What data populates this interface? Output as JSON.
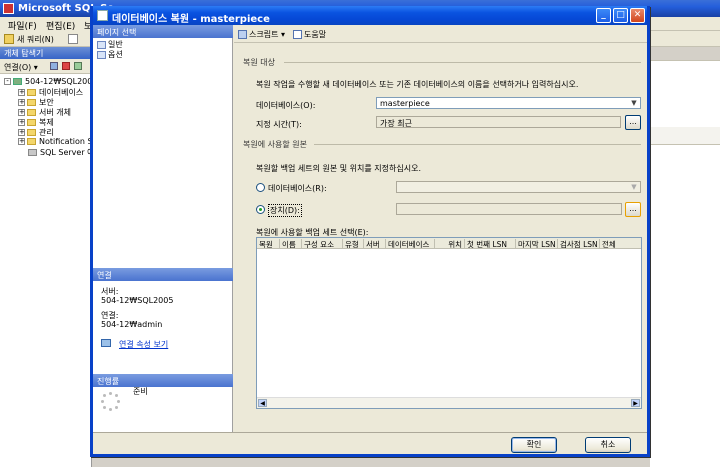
{
  "background_app": {
    "title": "Microsoft SQL Se",
    "menu": [
      "파일(F)",
      "편집(E)",
      "보"
    ],
    "toolbar_new_query": "새 쿼리(N)",
    "explorer_title": "개체 탐색기",
    "explorer_connect": "연결(O) ▾",
    "tree": [
      {
        "label": "504-12₩SQL2005",
        "expander": "-"
      },
      {
        "label": "데이터베이스",
        "expander": "+"
      },
      {
        "label": "보안",
        "expander": "+"
      },
      {
        "label": "서버 개체",
        "expander": "+"
      },
      {
        "label": "복제",
        "expander": "+"
      },
      {
        "label": "관리",
        "expander": "+"
      },
      {
        "label": "Notification Se",
        "expander": "+"
      },
      {
        "label": "SQL Server 에",
        "expander": ""
      }
    ]
  },
  "dialog": {
    "title": "데이터베이스 복원 - masterpiece",
    "left": {
      "page_select_header": "페이지 선택",
      "pages": [
        "일반",
        "옵션"
      ],
      "connection_header": "연결",
      "server_label": "서버:",
      "server_value": "504-12₩SQL2005",
      "conn_label": "연결:",
      "conn_value": "504-12₩admin",
      "conn_props_link": "연결 속성 보기",
      "progress_header": "진행률",
      "progress_status": "준비"
    },
    "toolbar": {
      "script": "스크립트",
      "help": "도움말"
    },
    "restore_target": {
      "section": "복원 대상",
      "description": "복원 작업을 수행할 새 데이터베이스 또는 기존 데이터베이스의 이름을 선택하거나 입력하십시오.",
      "db_label": "데이터베이스(O):",
      "db_value": "masterpiece",
      "time_label": "지정 시간(T):",
      "time_value": "가장 최근"
    },
    "restore_source": {
      "section": "복원에 사용할 원본",
      "description": "복원할 백업 세트의 원본 및 위치를 지정하십시오.",
      "from_db_label": "데이터베이스(R):",
      "from_device_label": "장치(D):",
      "selected": "device",
      "backup_sets_label": "복원에 사용할 백업 세트 선택(E):",
      "columns": [
        "복원",
        "이름",
        "구성 요소",
        "유형",
        "서버",
        "데이터베이스",
        "위치",
        "첫 번째 LSN",
        "마지막 LSN",
        "검사점 LSN",
        "전체"
      ]
    },
    "buttons": {
      "ok": "확인",
      "cancel": "취소",
      "ellipsis": "..."
    }
  }
}
